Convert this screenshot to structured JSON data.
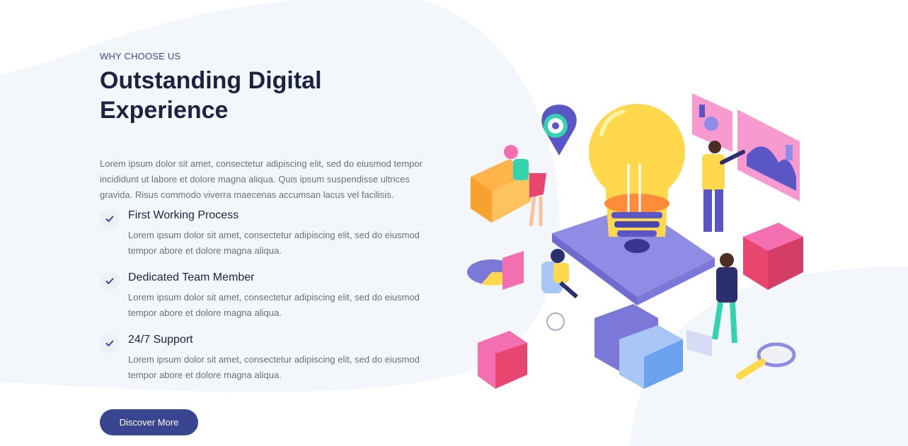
{
  "section": {
    "eyebrow": "WHY CHOOSE US",
    "title": "Outstanding Digital Experience",
    "intro": "Lorem ipsum dolor sit amet, consectetur adipiscing elit, sed do eiusmod tempor incididunt ut labore et dolore magna aliqua. Quis ipsum suspendisse ultrices gravida. Risus commodo viverra maecenas accumsan lacus vel facilisis."
  },
  "features": [
    {
      "title": "First Working Process",
      "description": "Lorem ipsum dolor sit amet, consectetur adipiscing elit, sed do eiusmod tempor abore et dolore magna aliqua.",
      "icon": "check-icon"
    },
    {
      "title": "Dedicated Team Member",
      "description": "Lorem ipsum dolor sit amet, consectetur adipiscing elit, sed do eiusmod tempor abore et dolore magna aliqua.",
      "icon": "check-icon"
    },
    {
      "title": "24/7 Support",
      "description": "Lorem ipsum dolor sit amet, consectetur adipiscing elit, sed do eiusmod tempor abore et dolore magna aliqua.",
      "icon": "check-icon"
    }
  ],
  "cta": {
    "label": "Discover More"
  },
  "colors": {
    "accent": "#3a4592",
    "heading": "#1c2340",
    "body": "#6b6f7b",
    "background_shape": "#f3f7fb"
  }
}
